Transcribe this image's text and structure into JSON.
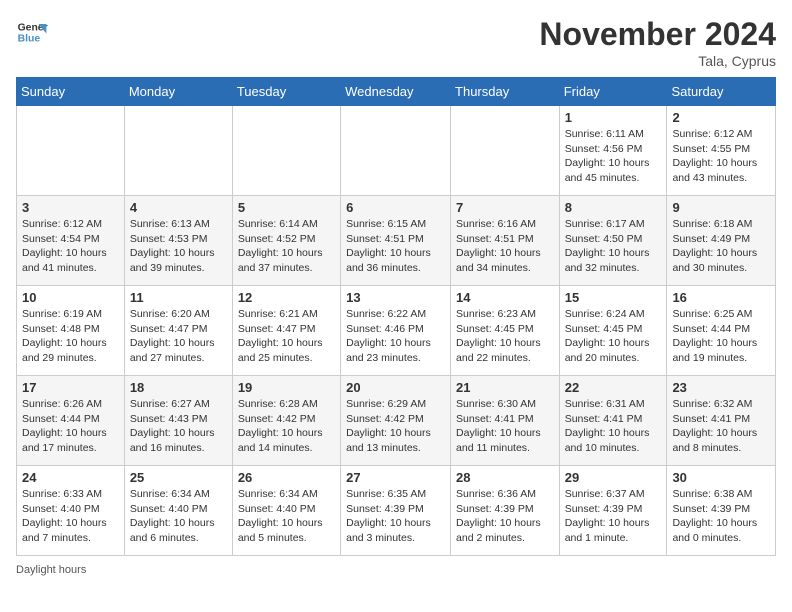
{
  "logo": {
    "line1": "General",
    "line2": "Blue"
  },
  "title": "November 2024",
  "location": "Tala, Cyprus",
  "days_of_week": [
    "Sunday",
    "Monday",
    "Tuesday",
    "Wednesday",
    "Thursday",
    "Friday",
    "Saturday"
  ],
  "footer_label": "Daylight hours",
  "weeks": [
    [
      {
        "day": "",
        "sunrise": "",
        "sunset": "",
        "daylight": ""
      },
      {
        "day": "",
        "sunrise": "",
        "sunset": "",
        "daylight": ""
      },
      {
        "day": "",
        "sunrise": "",
        "sunset": "",
        "daylight": ""
      },
      {
        "day": "",
        "sunrise": "",
        "sunset": "",
        "daylight": ""
      },
      {
        "day": "",
        "sunrise": "",
        "sunset": "",
        "daylight": ""
      },
      {
        "day": "1",
        "sunrise": "Sunrise: 6:11 AM",
        "sunset": "Sunset: 4:56 PM",
        "daylight": "Daylight: 10 hours and 45 minutes."
      },
      {
        "day": "2",
        "sunrise": "Sunrise: 6:12 AM",
        "sunset": "Sunset: 4:55 PM",
        "daylight": "Daylight: 10 hours and 43 minutes."
      }
    ],
    [
      {
        "day": "3",
        "sunrise": "Sunrise: 6:12 AM",
        "sunset": "Sunset: 4:54 PM",
        "daylight": "Daylight: 10 hours and 41 minutes."
      },
      {
        "day": "4",
        "sunrise": "Sunrise: 6:13 AM",
        "sunset": "Sunset: 4:53 PM",
        "daylight": "Daylight: 10 hours and 39 minutes."
      },
      {
        "day": "5",
        "sunrise": "Sunrise: 6:14 AM",
        "sunset": "Sunset: 4:52 PM",
        "daylight": "Daylight: 10 hours and 37 minutes."
      },
      {
        "day": "6",
        "sunrise": "Sunrise: 6:15 AM",
        "sunset": "Sunset: 4:51 PM",
        "daylight": "Daylight: 10 hours and 36 minutes."
      },
      {
        "day": "7",
        "sunrise": "Sunrise: 6:16 AM",
        "sunset": "Sunset: 4:51 PM",
        "daylight": "Daylight: 10 hours and 34 minutes."
      },
      {
        "day": "8",
        "sunrise": "Sunrise: 6:17 AM",
        "sunset": "Sunset: 4:50 PM",
        "daylight": "Daylight: 10 hours and 32 minutes."
      },
      {
        "day": "9",
        "sunrise": "Sunrise: 6:18 AM",
        "sunset": "Sunset: 4:49 PM",
        "daylight": "Daylight: 10 hours and 30 minutes."
      }
    ],
    [
      {
        "day": "10",
        "sunrise": "Sunrise: 6:19 AM",
        "sunset": "Sunset: 4:48 PM",
        "daylight": "Daylight: 10 hours and 29 minutes."
      },
      {
        "day": "11",
        "sunrise": "Sunrise: 6:20 AM",
        "sunset": "Sunset: 4:47 PM",
        "daylight": "Daylight: 10 hours and 27 minutes."
      },
      {
        "day": "12",
        "sunrise": "Sunrise: 6:21 AM",
        "sunset": "Sunset: 4:47 PM",
        "daylight": "Daylight: 10 hours and 25 minutes."
      },
      {
        "day": "13",
        "sunrise": "Sunrise: 6:22 AM",
        "sunset": "Sunset: 4:46 PM",
        "daylight": "Daylight: 10 hours and 23 minutes."
      },
      {
        "day": "14",
        "sunrise": "Sunrise: 6:23 AM",
        "sunset": "Sunset: 4:45 PM",
        "daylight": "Daylight: 10 hours and 22 minutes."
      },
      {
        "day": "15",
        "sunrise": "Sunrise: 6:24 AM",
        "sunset": "Sunset: 4:45 PM",
        "daylight": "Daylight: 10 hours and 20 minutes."
      },
      {
        "day": "16",
        "sunrise": "Sunrise: 6:25 AM",
        "sunset": "Sunset: 4:44 PM",
        "daylight": "Daylight: 10 hours and 19 minutes."
      }
    ],
    [
      {
        "day": "17",
        "sunrise": "Sunrise: 6:26 AM",
        "sunset": "Sunset: 4:44 PM",
        "daylight": "Daylight: 10 hours and 17 minutes."
      },
      {
        "day": "18",
        "sunrise": "Sunrise: 6:27 AM",
        "sunset": "Sunset: 4:43 PM",
        "daylight": "Daylight: 10 hours and 16 minutes."
      },
      {
        "day": "19",
        "sunrise": "Sunrise: 6:28 AM",
        "sunset": "Sunset: 4:42 PM",
        "daylight": "Daylight: 10 hours and 14 minutes."
      },
      {
        "day": "20",
        "sunrise": "Sunrise: 6:29 AM",
        "sunset": "Sunset: 4:42 PM",
        "daylight": "Daylight: 10 hours and 13 minutes."
      },
      {
        "day": "21",
        "sunrise": "Sunrise: 6:30 AM",
        "sunset": "Sunset: 4:41 PM",
        "daylight": "Daylight: 10 hours and 11 minutes."
      },
      {
        "day": "22",
        "sunrise": "Sunrise: 6:31 AM",
        "sunset": "Sunset: 4:41 PM",
        "daylight": "Daylight: 10 hours and 10 minutes."
      },
      {
        "day": "23",
        "sunrise": "Sunrise: 6:32 AM",
        "sunset": "Sunset: 4:41 PM",
        "daylight": "Daylight: 10 hours and 8 minutes."
      }
    ],
    [
      {
        "day": "24",
        "sunrise": "Sunrise: 6:33 AM",
        "sunset": "Sunset: 4:40 PM",
        "daylight": "Daylight: 10 hours and 7 minutes."
      },
      {
        "day": "25",
        "sunrise": "Sunrise: 6:34 AM",
        "sunset": "Sunset: 4:40 PM",
        "daylight": "Daylight: 10 hours and 6 minutes."
      },
      {
        "day": "26",
        "sunrise": "Sunrise: 6:34 AM",
        "sunset": "Sunset: 4:40 PM",
        "daylight": "Daylight: 10 hours and 5 minutes."
      },
      {
        "day": "27",
        "sunrise": "Sunrise: 6:35 AM",
        "sunset": "Sunset: 4:39 PM",
        "daylight": "Daylight: 10 hours and 3 minutes."
      },
      {
        "day": "28",
        "sunrise": "Sunrise: 6:36 AM",
        "sunset": "Sunset: 4:39 PM",
        "daylight": "Daylight: 10 hours and 2 minutes."
      },
      {
        "day": "29",
        "sunrise": "Sunrise: 6:37 AM",
        "sunset": "Sunset: 4:39 PM",
        "daylight": "Daylight: 10 hours and 1 minute."
      },
      {
        "day": "30",
        "sunrise": "Sunrise: 6:38 AM",
        "sunset": "Sunset: 4:39 PM",
        "daylight": "Daylight: 10 hours and 0 minutes."
      }
    ]
  ]
}
